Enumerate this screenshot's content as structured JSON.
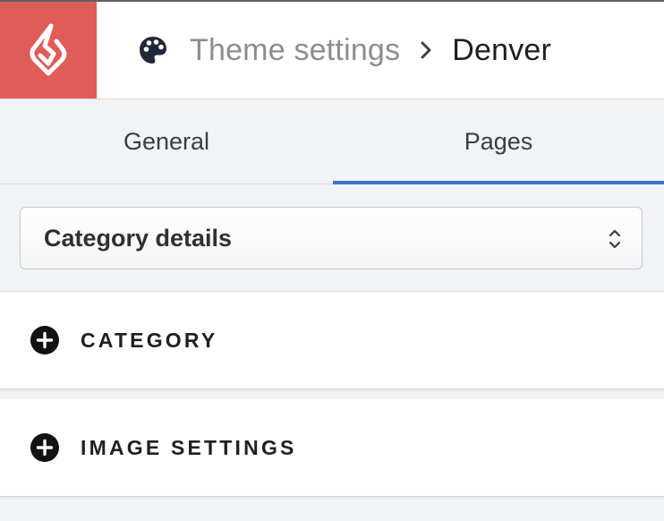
{
  "header": {
    "logo_icon": "lightspeed-flame-icon",
    "logo_color": "#e05c59",
    "breadcrumb_icon": "palette-icon",
    "breadcrumb_parent": "Theme settings",
    "breadcrumb_separator_icon": "chevron-right-icon",
    "breadcrumb_current": "Denver"
  },
  "tabs": [
    {
      "label": "General",
      "active": false
    },
    {
      "label": "Pages",
      "active": true
    }
  ],
  "accent_color": "#3a76c8",
  "page_select": {
    "value": "Category details",
    "icon": "select-arrows-icon"
  },
  "sections": [
    {
      "title": "CATEGORY",
      "icon": "plus-circle-icon"
    },
    {
      "title": "IMAGE SETTINGS",
      "icon": "plus-circle-icon"
    }
  ]
}
